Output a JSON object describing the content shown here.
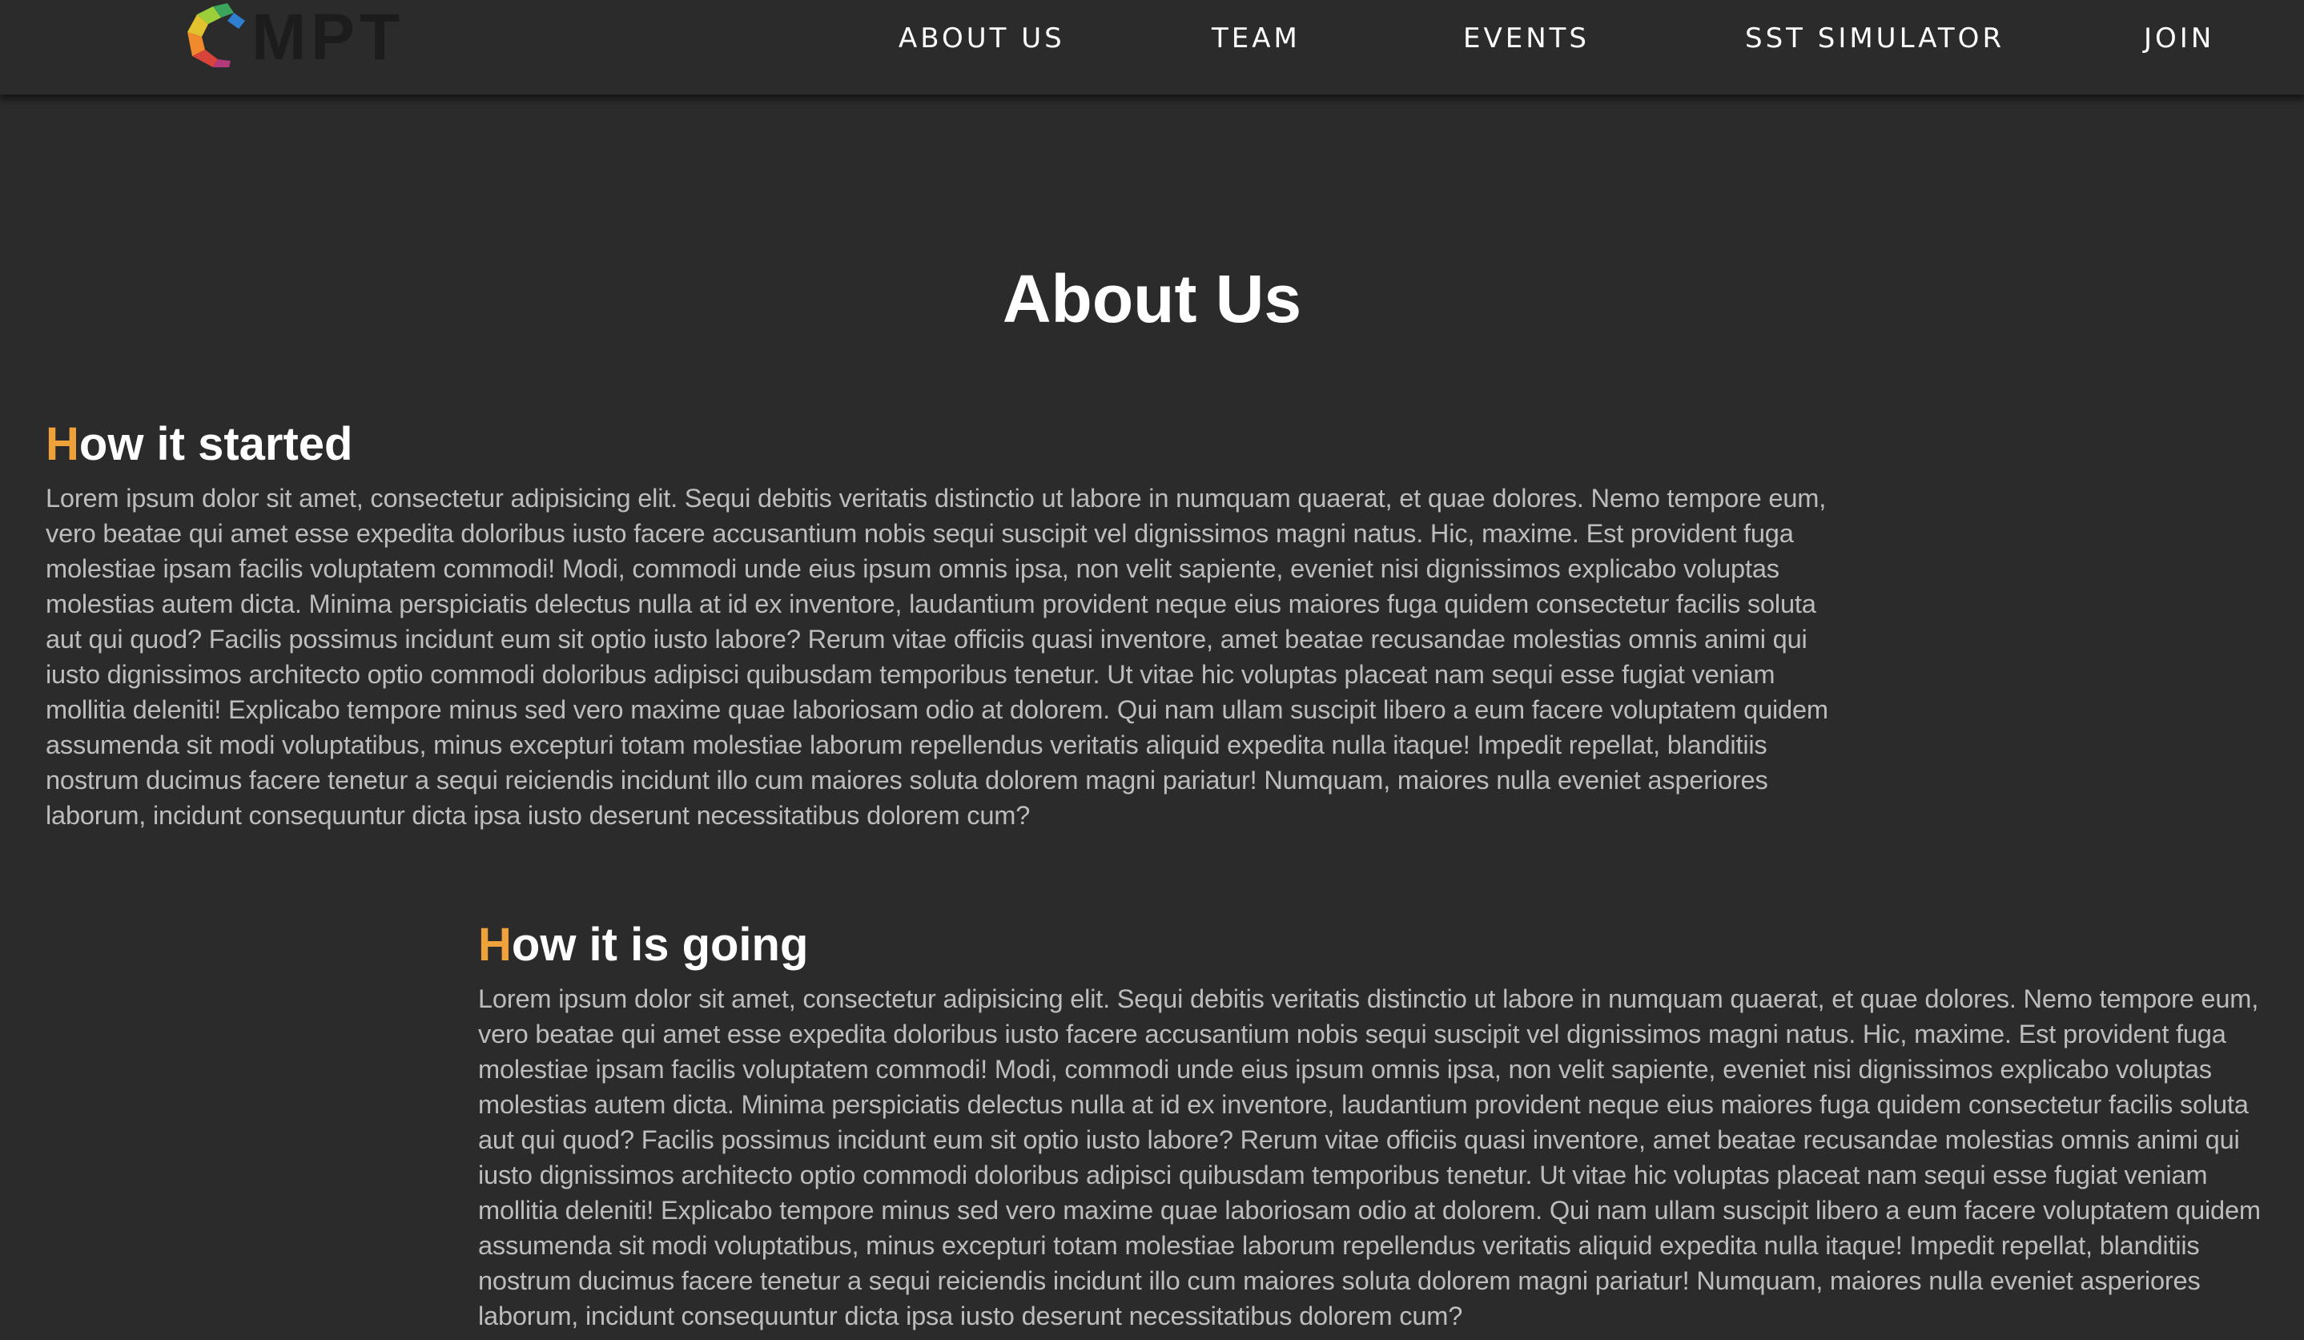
{
  "header": {
    "logo_text": "MPT",
    "nav": [
      {
        "label": "ABOUT US"
      },
      {
        "label": "TEAM"
      },
      {
        "label": "EVENTS"
      },
      {
        "label": "SST SIMULATOR"
      },
      {
        "label": "JOIN"
      }
    ]
  },
  "colors": {
    "background": "#2b2b2b",
    "accent": "#f0a23a",
    "body_text": "#bdbdbd",
    "heading_text": "#ffffff"
  },
  "main": {
    "title": "About Us",
    "sections": [
      {
        "heading_initial": "H",
        "heading_rest": "ow it started",
        "body": "Lorem ipsum dolor sit amet, consectetur adipisicing elit. Sequi debitis veritatis distinctio ut labore in numquam quaerat, et quae dolores. Nemo tempore eum, vero beatae qui amet esse expedita doloribus iusto facere accusantium nobis sequi suscipit vel dignissimos magni natus. Hic, maxime. Est provident fuga molestiae ipsam facilis voluptatem commodi! Modi, commodi unde eius ipsum omnis ipsa, non velit sapiente, eveniet nisi dignissimos explicabo voluptas molestias autem dicta. Minima perspiciatis delectus nulla at id ex inventore, laudantium provident neque eius maiores fuga quidem consectetur facilis soluta aut qui quod? Facilis possimus incidunt eum sit optio iusto labore? Rerum vitae officiis quasi inventore, amet beatae recusandae molestias omnis animi qui iusto dignissimos architecto optio commodi doloribus adipisci quibusdam temporibus tenetur. Ut vitae hic voluptas placeat nam sequi esse fugiat veniam mollitia deleniti! Explicabo tempore minus sed vero maxime quae laboriosam odio at dolorem. Qui nam ullam suscipit libero a eum facere voluptatem quidem assumenda sit modi voluptatibus, minus excepturi totam molestiae laborum repellendus veritatis aliquid expedita nulla itaque! Impedit repellat, blanditiis nostrum ducimus facere tenetur a sequi reiciendis incidunt illo cum maiores soluta dolorem magni pariatur! Numquam, maiores nulla eveniet asperiores laborum, incidunt consequuntur dicta ipsa iusto deserunt necessitatibus dolorem cum?"
      },
      {
        "heading_initial": "H",
        "heading_rest": "ow it is going",
        "body": "Lorem ipsum dolor sit amet, consectetur adipisicing elit. Sequi debitis veritatis distinctio ut labore in numquam quaerat, et quae dolores. Nemo tempore eum, vero beatae qui amet esse expedita doloribus iusto facere accusantium nobis sequi suscipit vel dignissimos magni natus. Hic, maxime. Est provident fuga molestiae ipsam facilis voluptatem commodi! Modi, commodi unde eius ipsum omnis ipsa, non velit sapiente, eveniet nisi dignissimos explicabo voluptas molestias autem dicta. Minima perspiciatis delectus nulla at id ex inventore, laudantium provident neque eius maiores fuga quidem consectetur facilis soluta aut qui quod? Facilis possimus incidunt eum sit optio iusto labore? Rerum vitae officiis quasi inventore, amet beatae recusandae molestias omnis animi qui iusto dignissimos architecto optio commodi doloribus adipisci quibusdam temporibus tenetur. Ut vitae hic voluptas placeat nam sequi esse fugiat veniam mollitia deleniti! Explicabo tempore minus sed vero maxime quae laboriosam odio at dolorem. Qui nam ullam suscipit libero a eum facere voluptatem quidem assumenda sit modi voluptatibus, minus excepturi totam molestiae laborum repellendus veritatis aliquid expedita nulla itaque! Impedit repellat, blanditiis nostrum ducimus facere tenetur a sequi reiciendis incidunt illo cum maiores soluta dolorem magni pariatur! Numquam, maiores nulla eveniet asperiores laborum, incidunt consequuntur dicta ipsa iusto deserunt necessitatibus dolorem cum?"
      }
    ]
  }
}
